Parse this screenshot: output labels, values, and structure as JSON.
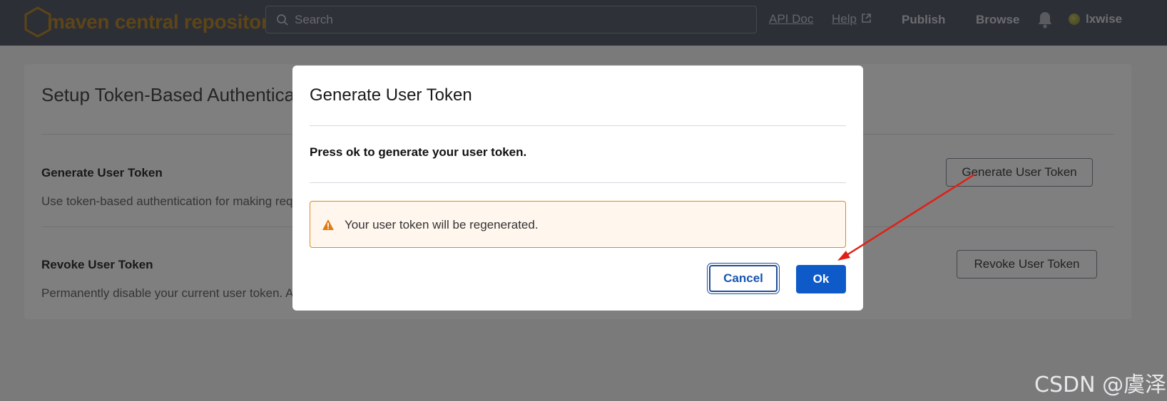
{
  "header": {
    "logo_text": "maven central repository",
    "search_placeholder": "Search",
    "nav": {
      "api_doc": "API Doc",
      "help": "Help",
      "publish": "Publish",
      "browse": "Browse"
    },
    "username": "lxwise"
  },
  "card": {
    "title": "Setup Token-Based Authenticat",
    "generate": {
      "title": "Generate User Token",
      "description": "Use token-based authentication for making req",
      "button": "Generate User Token"
    },
    "revoke": {
      "title": "Revoke User Token",
      "description": "Permanently disable your current user token. A",
      "button": "Revoke User Token"
    }
  },
  "modal": {
    "title": "Generate User Token",
    "body": "Press ok to generate your user token.",
    "warning": "Your user token will be regenerated.",
    "cancel_label": "Cancel",
    "ok_label": "Ok"
  },
  "colors": {
    "header_bg": "#5a5e6e",
    "brand": "#b88a2f",
    "primary": "#0e5ac8",
    "warning_border": "#e08a1c",
    "warning_bg": "#fff6ee",
    "annotation_arrow": "#e02015"
  },
  "watermark": "CSDN @虞泽"
}
